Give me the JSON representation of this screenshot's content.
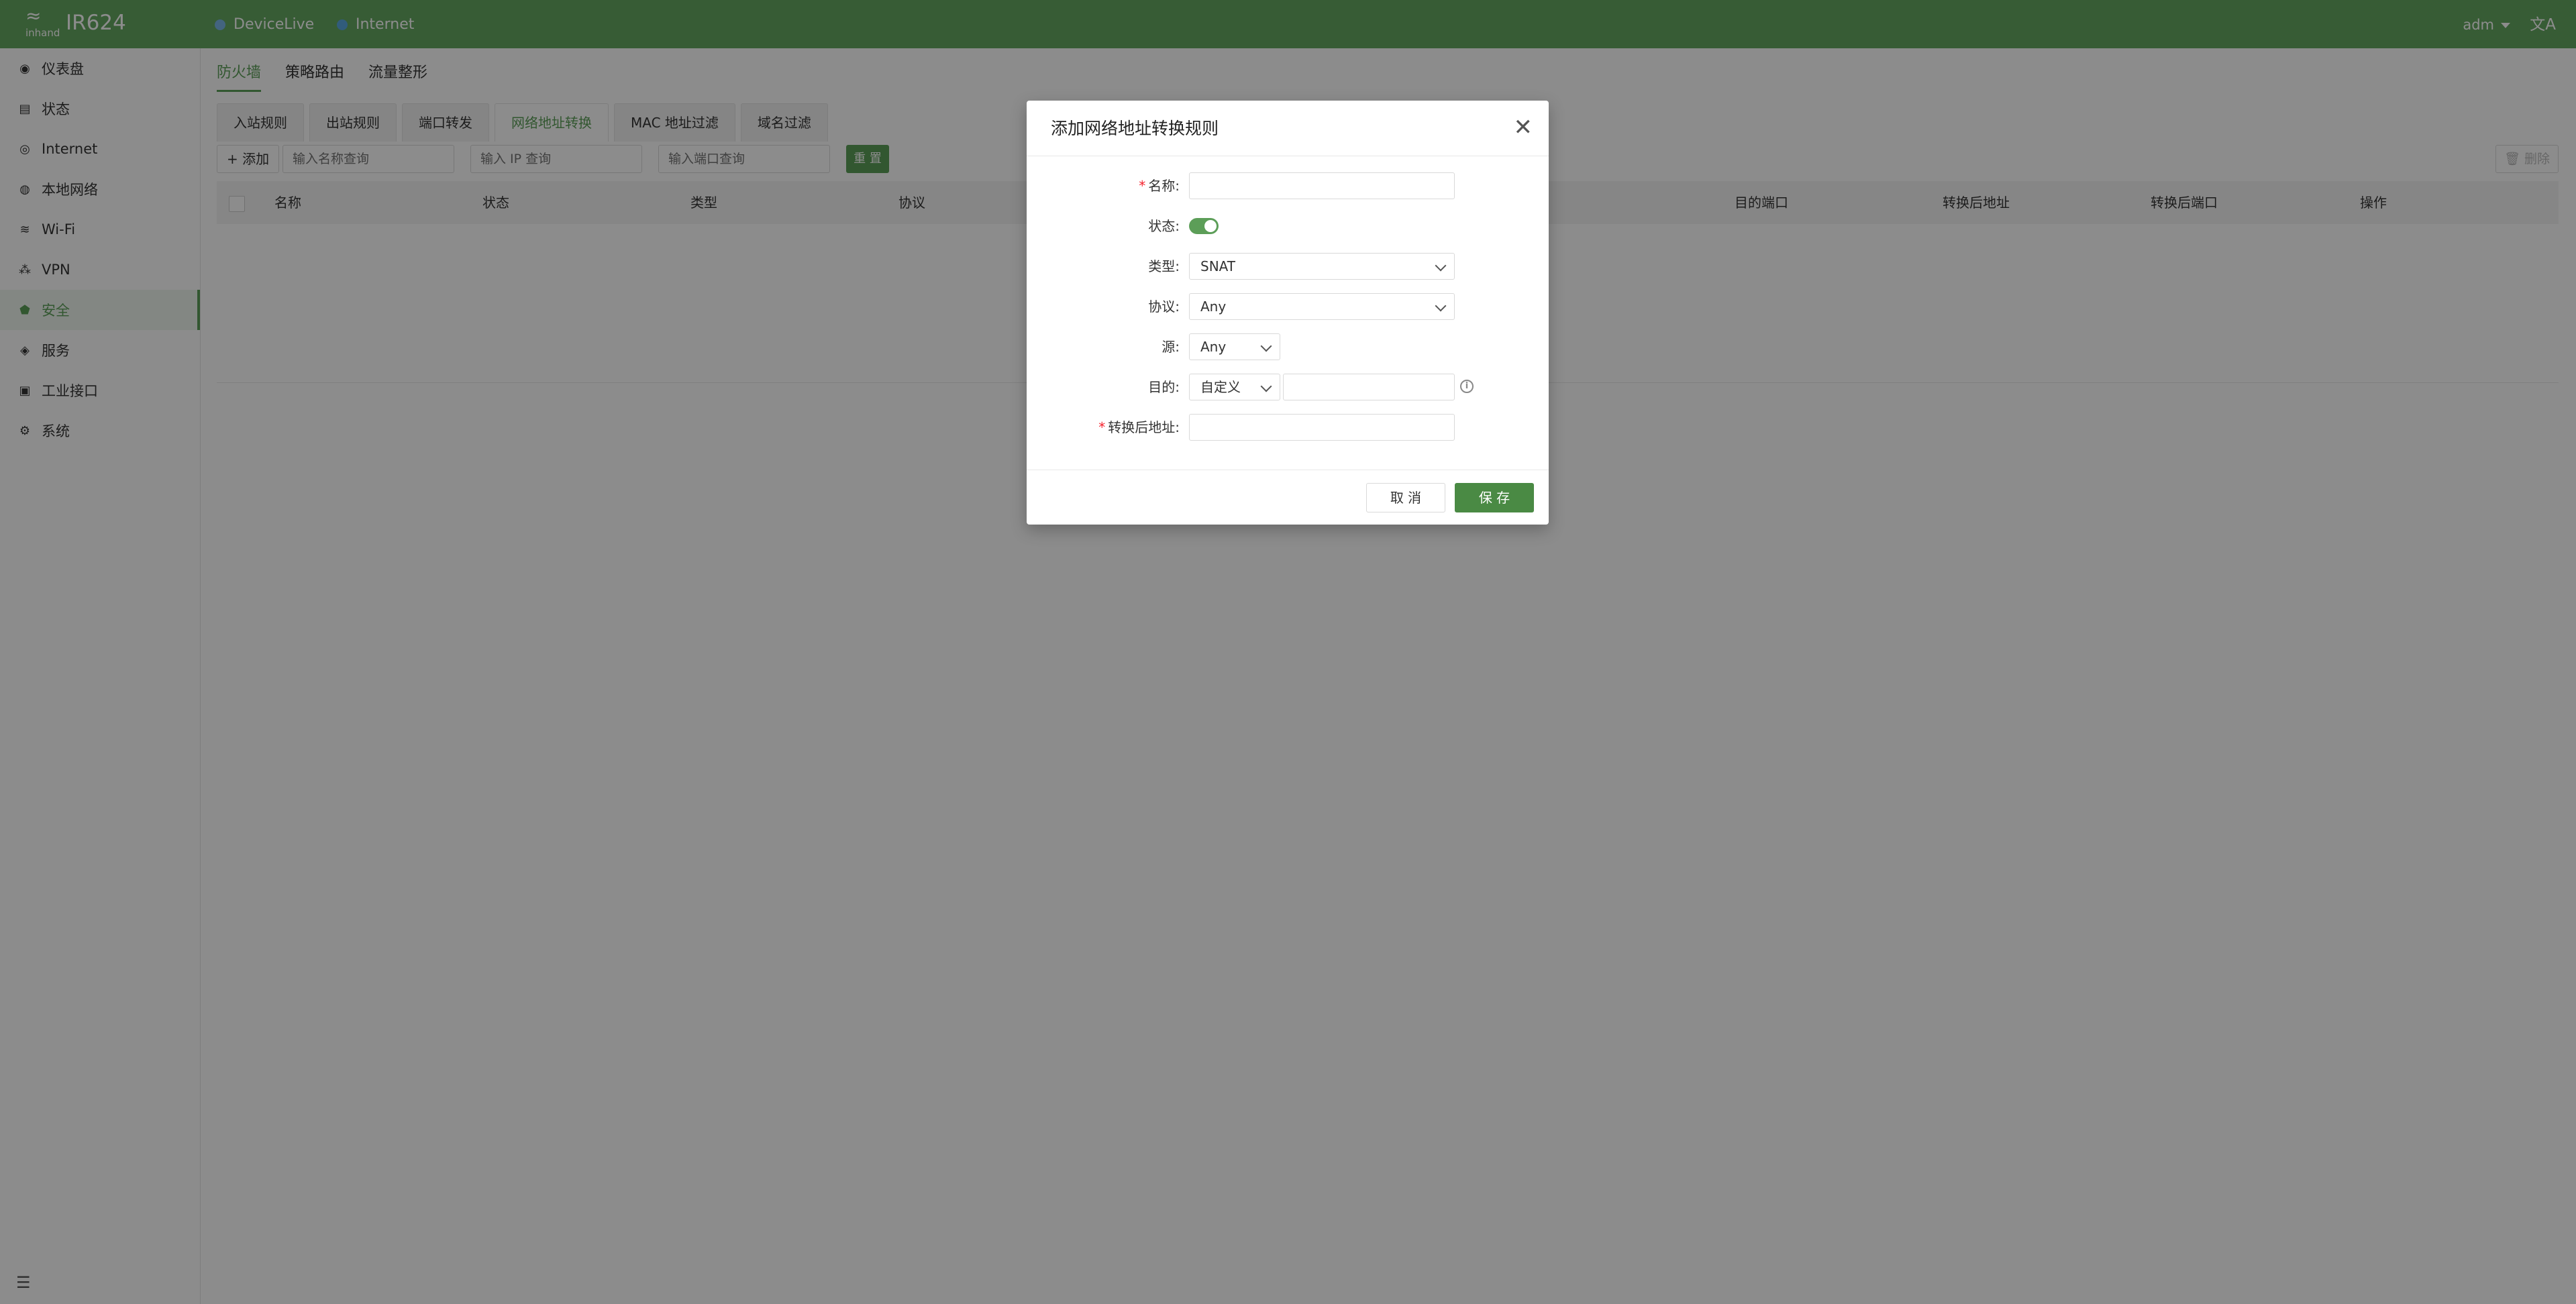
{
  "header": {
    "logo_mark": "≈",
    "logo_sub": "inhand",
    "brand": "IR624",
    "links": [
      {
        "label": "DeviceLive",
        "color": "#7ab6e8"
      },
      {
        "label": "Internet",
        "color": "#5aa8e0"
      }
    ],
    "user": "adm",
    "lang_icon": "文A"
  },
  "sidebar": {
    "items": [
      {
        "label": "仪表盘",
        "icon": "dashboard-icon"
      },
      {
        "label": "状态",
        "icon": "status-icon"
      },
      {
        "label": "Internet",
        "icon": "globe-icon"
      },
      {
        "label": "本地网络",
        "icon": "network-icon"
      },
      {
        "label": "Wi-Fi",
        "icon": "wifi-icon"
      },
      {
        "label": "VPN",
        "icon": "vpn-icon"
      },
      {
        "label": "安全",
        "icon": "shield-icon"
      },
      {
        "label": "服务",
        "icon": "service-icon"
      },
      {
        "label": "工业接口",
        "icon": "interface-icon"
      },
      {
        "label": "系统",
        "icon": "gear-icon"
      }
    ],
    "active": "安全"
  },
  "main": {
    "tabs": [
      "防火墙",
      "策略路由",
      "流量整形"
    ],
    "subtabs": [
      "入站规则",
      "出站规则",
      "端口转发",
      "网络地址转换",
      "MAC 地址过滤",
      "域名过滤"
    ],
    "toolbar": {
      "add_label": "+ 添加",
      "search_name_placeholder": "输入名称查询",
      "search_ip_placeholder": "输入 IP 查询",
      "search_port_placeholder": "输入端口查询",
      "reset_label": "重 置",
      "delete_label": "删除"
    },
    "table": {
      "columns": [
        "名称",
        "状态",
        "类型",
        "协议",
        "目的端口",
        "转换后地址",
        "转换后端口",
        "操作"
      ]
    }
  },
  "modal": {
    "title": "添加网络地址转换规则",
    "fields": {
      "name_label": "名称:",
      "status_label": "状态:",
      "type_label": "类型:",
      "type_value": "SNAT",
      "protocol_label": "协议:",
      "protocol_value": "Any",
      "source_label": "源:",
      "source_value": "Any",
      "dest_label": "目的:",
      "dest_value": "自定义",
      "translated_label": "转换后地址:"
    },
    "cancel_label": "取 消",
    "save_label": "保 存"
  }
}
